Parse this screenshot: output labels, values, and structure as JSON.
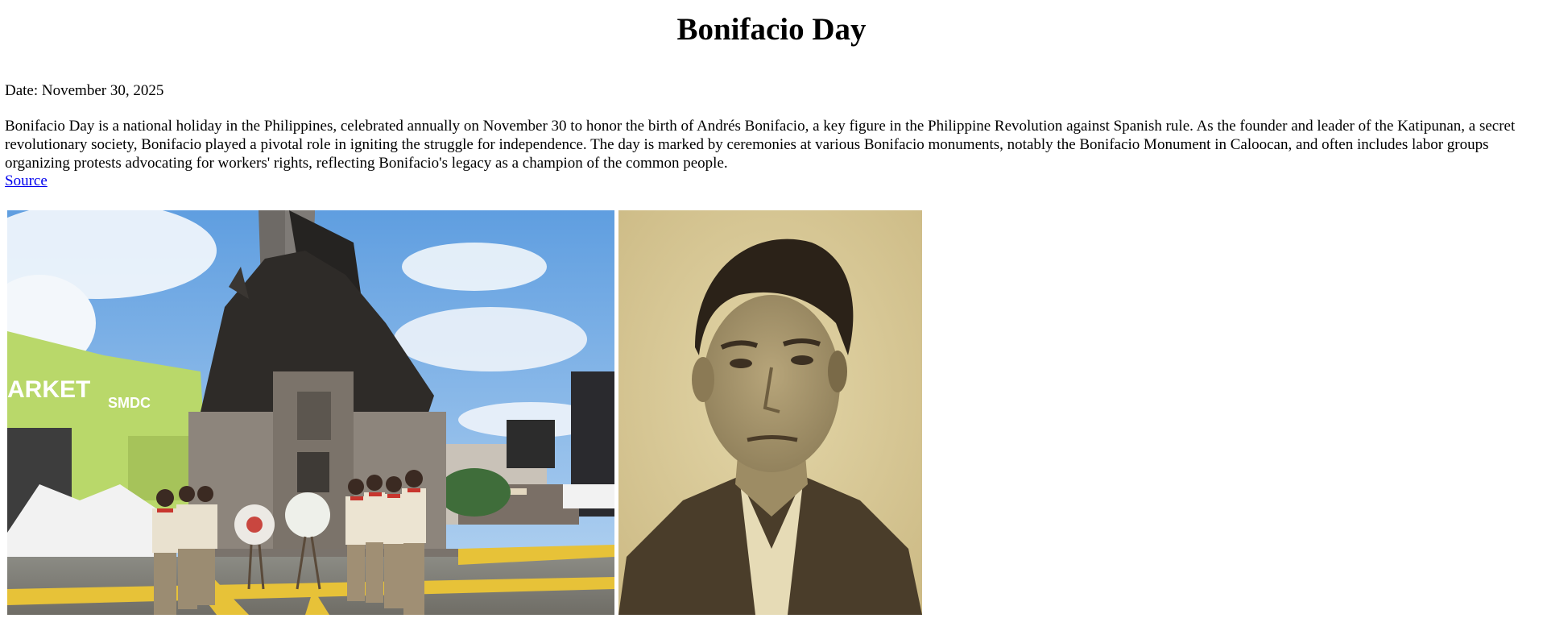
{
  "page": {
    "title": "Bonifacio Day",
    "date": "Date: November 30, 2025",
    "description": "Bonifacio Day is a national holiday in the Philippines, celebrated annually on November 30 to honor the birth of Andrés Bonifacio, a key figure in the Philippine Revolution against Spanish rule. As the founder and leader of the Katipunan, a secret revolutionary society, Bonifacio played a pivotal role in igniting the struggle for independence. The day is marked by ceremonies at various Bonifacio monuments, notably the Bonifacio Monument in Caloocan, and often includes labor groups organizing protests advocating for workers' rights, reflecting Bonifacio's legacy as a champion of the common people.",
    "source_label": "Source"
  },
  "images": {
    "monument_sign_text": "ARKET",
    "monument_sign_text_2": "SMDC"
  },
  "colors": {
    "link": "#0000ee",
    "sky": "#7fb2e8",
    "sepia": "#d9c99a"
  }
}
